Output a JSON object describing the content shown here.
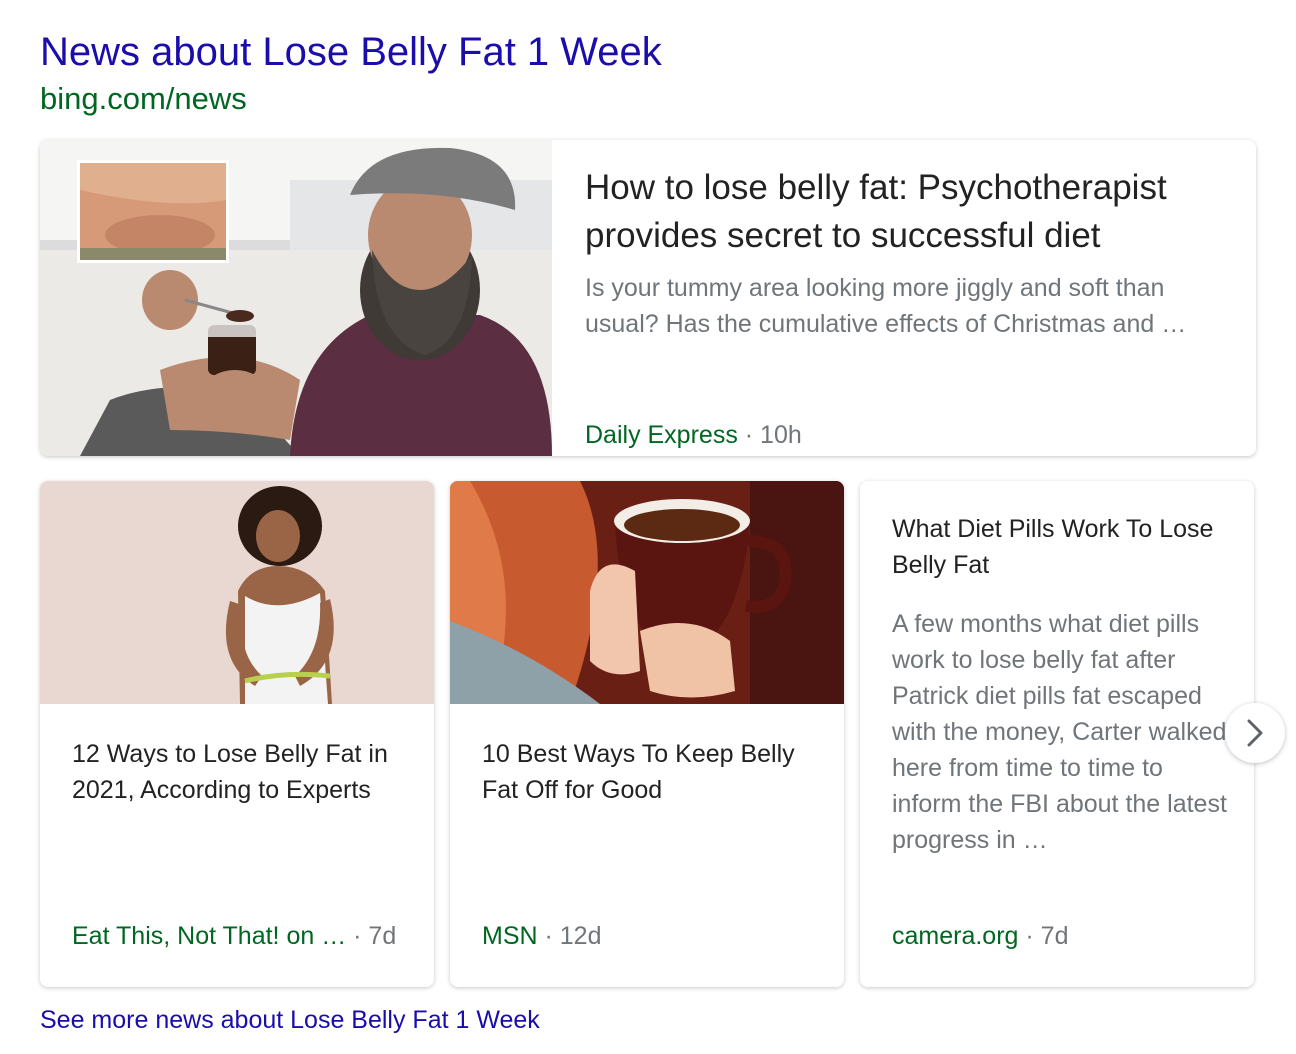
{
  "header": {
    "title": "News about Lose Belly Fat 1 Week",
    "url": "bing.com/news"
  },
  "featured": {
    "headline": "How to lose belly fat: Psychotherapist provides secret to successful diet",
    "snippet": "Is your tummy area looking more jiggly and soft than usual? Has the cumulative effects of Christmas and …",
    "publisher": "Daily Express",
    "age": " · 10h",
    "image_icon": "man-eating-pudding-photo"
  },
  "cards": [
    {
      "headline": "12 Ways to Lose Belly Fat in 2021, According to Experts",
      "publisher": "Eat This, Not That! on …",
      "age": " · 7d",
      "image_icon": "woman-measuring-waist-photo"
    },
    {
      "headline": "10 Best Ways To Keep Belly Fat Off for Good",
      "publisher": "MSN",
      "age": " · 12d",
      "image_icon": "hands-holding-tea-cup-photo"
    },
    {
      "headline": "What Diet Pills Work To Lose Belly Fat",
      "snippet": "A few months what diet pills work to lose belly fat after Patrick diet pills fat escaped with the money, Carter walked here from time to time to inform the FBI about the latest progress in …",
      "publisher": "camera.org",
      "age": " · 7d"
    }
  ],
  "carousel": {
    "next_icon": "chevron-right-icon"
  },
  "footer": {
    "see_more": "See more news about Lose Belly Fat 1 Week"
  },
  "colors": {
    "link": "#1a0dab",
    "source_green": "#006621",
    "snippet_gray": "#70757a",
    "headline": "#222222"
  }
}
